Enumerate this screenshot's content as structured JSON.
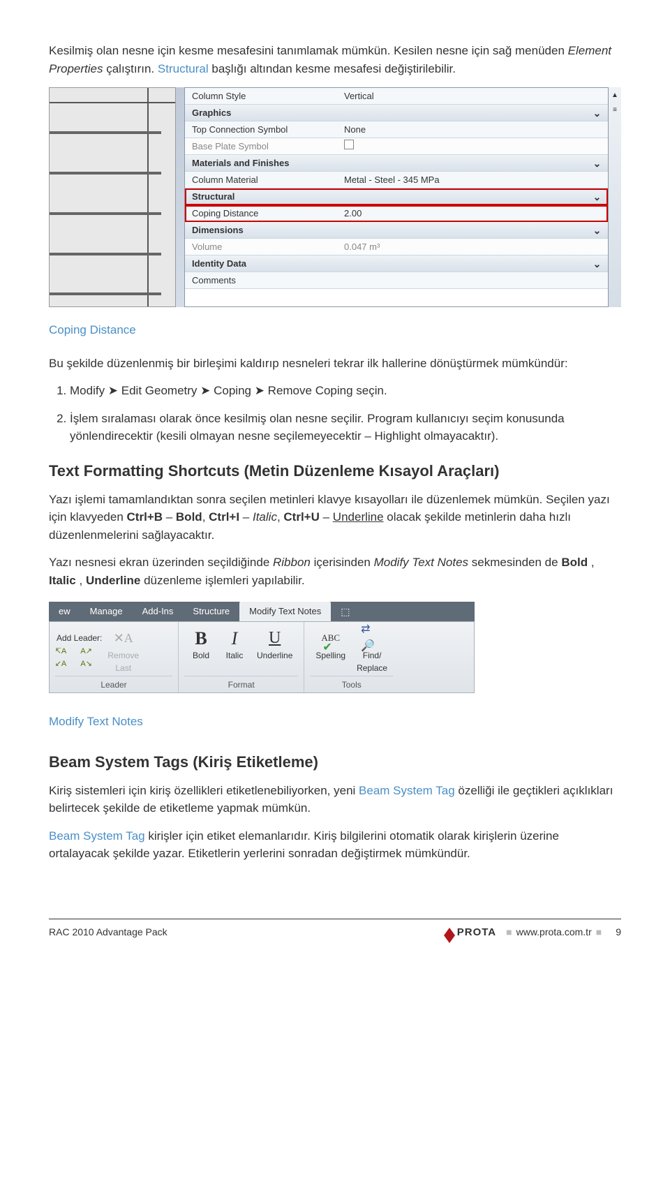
{
  "intro": {
    "p1_a": "Kesilmiş olan nesne için kesme mesafesini tanımlamak mümkün. Kesilen nesne için sağ menüden ",
    "p1_em": "Element Properties",
    "p1_b": " çalıştırın. ",
    "p1_term": "Structural",
    "p1_c": " başlığı altından kesme mesafesi değiştirilebilir."
  },
  "propgrid": {
    "rows": [
      {
        "k": "Column Style",
        "v": "Vertical",
        "cls": "pg-lightrow"
      },
      {
        "k": "Graphics",
        "header": true
      },
      {
        "k": "Top Connection Symbol",
        "v": "None",
        "cls": "pg-lightrow"
      },
      {
        "k": "Base Plate Symbol",
        "checkbox": true,
        "cls": "pg-dimrow"
      },
      {
        "k": "Materials and Finishes",
        "header": true
      },
      {
        "k": "Column Material",
        "v": "Metal - Steel - 345 MPa",
        "cls": "pg-lightrow"
      },
      {
        "k": "Structural",
        "header": true,
        "red": true
      },
      {
        "k": "Coping Distance",
        "v": "2.00",
        "cls": "pg-lightrow",
        "red": true
      },
      {
        "k": "Dimensions",
        "header": true
      },
      {
        "k": "Volume",
        "v": "0.047 m³",
        "cls": "pg-dimrow"
      },
      {
        "k": "Identity Data",
        "header": true
      },
      {
        "k": "Comments",
        "v": "",
        "cls": "pg-lightrow"
      }
    ],
    "scroll_thumb": "≡"
  },
  "caption1": "Coping Distance",
  "midtext": "Bu şekilde düzenlenmiş bir birleşimi kaldırıp nesneleri tekrar ilk hallerine dönüştürmek mümkündür:",
  "steps": [
    "Modify ➤ Edit Geometry ➤ Coping ➤ Remove Coping seçin.",
    "İşlem sıralaması olarak önce kesilmiş olan nesne seçilir. Program kullanıcıyı seçim konusunda yönlendirecektir (kesili olmayan nesne seçilemeyecektir – Highlight olmayacaktır)."
  ],
  "section1": {
    "h": "Text Formatting Shortcuts (Metin Düzenleme Kısayol Araçları)",
    "p1a": "Yazı işlemi tamamlandıktan sonra seçilen metinleri klavye kısayolları ile düzenlemek mümkün. Seçilen yazı için klavyeden ",
    "k1": "Ctrl+B",
    "d1": " – ",
    "b": "Bold",
    "c1": ", ",
    "k2": "Ctrl+I",
    "d2": " – ",
    "i": "Italic",
    "c2": ", ",
    "k3": "Ctrl+U",
    "d3": " – ",
    "u": "Underline",
    "p1b": " olacak şekilde metinlerin daha hızlı düzenlenmelerini sağlayacaktır.",
    "p2a": "Yazı nesnesi ekran üzerinden seçildiğinde ",
    "p2i1": "Ribbon",
    "p2b": " içerisinden ",
    "p2i2": "Modify Text Notes",
    "p2c": " sekmesinden de ",
    "p2bold": "Bold",
    "p2d": ", ",
    "p2it": "Italic",
    "p2e": ", ",
    "p2ul": "Underline",
    "p2f": " düzenleme işlemleri yapılabilir."
  },
  "ribbon": {
    "tabs": [
      "ew",
      "Manage",
      "Add-Ins",
      "Structure",
      "Modify Text Notes"
    ],
    "leader": {
      "add": "Add Leader:",
      "remove_label1": "Remove",
      "remove_label2": "Last",
      "group": "Leader"
    },
    "format": {
      "bold": "Bold",
      "italic": "Italic",
      "underline": "Underline",
      "group": "Format"
    },
    "tools": {
      "spelling": "Spelling",
      "find1": "Find/",
      "find2": "Replace",
      "group": "Tools"
    }
  },
  "caption2": "Modify Text Notes",
  "section2": {
    "h": "Beam System Tags (Kiriş Etiketleme)",
    "p1a": "Kiriş sistemleri için kiriş özellikleri etiketlenebiliyorken, yeni ",
    "term": "Beam System Tag",
    "p1b": " özelliği ile geçtikleri açıklıkları belirtecek şekilde de etiketleme yapmak mümkün.",
    "p2a": "Beam System Tag",
    "p2b": " kirişler için etiket elemanlarıdır. Kiriş bilgilerini otomatik olarak kirişlerin üzerine ortalayacak şekilde yazar. Etiketlerin yerlerini sonradan değiştirmek mümkündür."
  },
  "footer": {
    "left": "RAC 2010 Advantage Pack",
    "brand": "PROTA",
    "url": "www.prota.com.tr",
    "page": "9"
  }
}
